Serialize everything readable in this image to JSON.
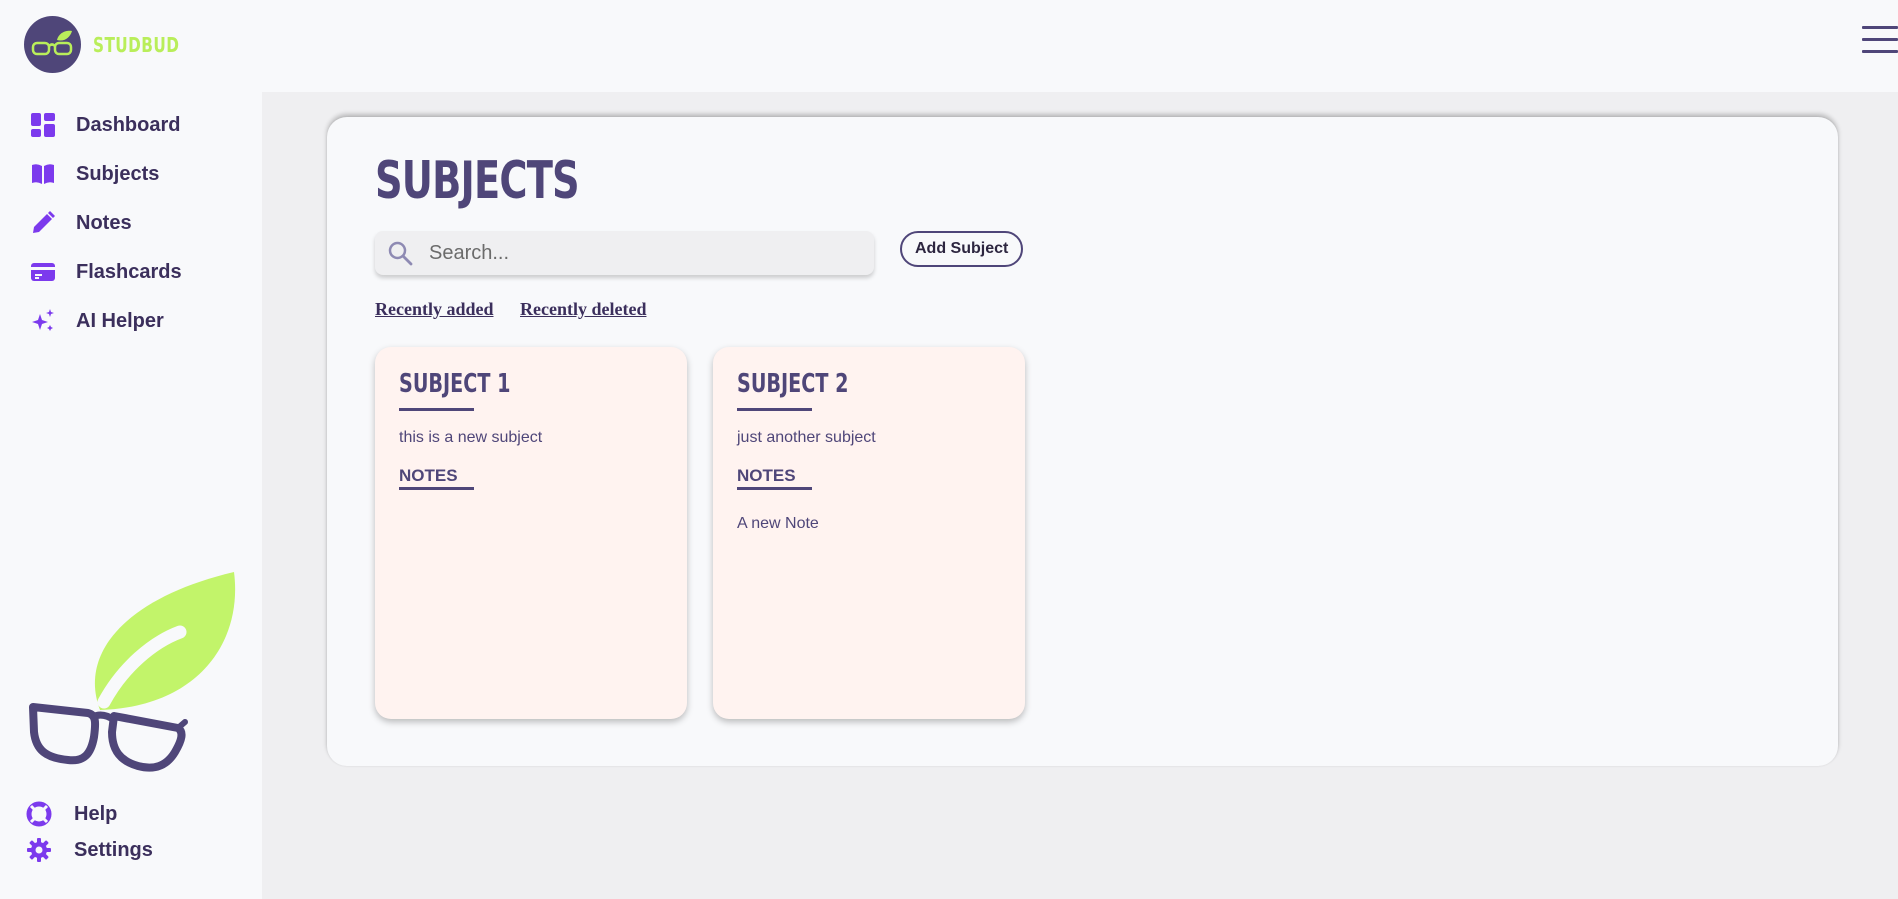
{
  "brand": {
    "name": "STUDBUD"
  },
  "sidebar": {
    "items": [
      {
        "label": "Dashboard",
        "icon": "dashboard-icon"
      },
      {
        "label": "Subjects",
        "icon": "book-icon"
      },
      {
        "label": "Notes",
        "icon": "pencil-icon"
      },
      {
        "label": "Flashcards",
        "icon": "card-icon"
      },
      {
        "label": "AI Helper",
        "icon": "sparkles-icon"
      }
    ],
    "footer": [
      {
        "label": "Help",
        "icon": "lifebuoy-icon"
      },
      {
        "label": "Settings",
        "icon": "gear-icon"
      }
    ]
  },
  "main": {
    "title": "SUBJECTS",
    "search": {
      "placeholder": "Search...",
      "value": ""
    },
    "add_button": "Add Subject",
    "links": {
      "recently_added": "Recently added",
      "recently_deleted": "Recently deleted"
    },
    "subjects": [
      {
        "title": "SUBJECT 1",
        "description": "this is a new subject",
        "notes_heading": "NOTES",
        "notes": []
      },
      {
        "title": "SUBJECT 2",
        "description": "just another subject",
        "notes_heading": "NOTES",
        "notes": [
          "A new Note"
        ]
      }
    ]
  },
  "colors": {
    "accent": "#7c3aed",
    "brand_purple": "#4f4679",
    "brand_green": "#c2f46a",
    "card_bg": "#fff3f0"
  }
}
